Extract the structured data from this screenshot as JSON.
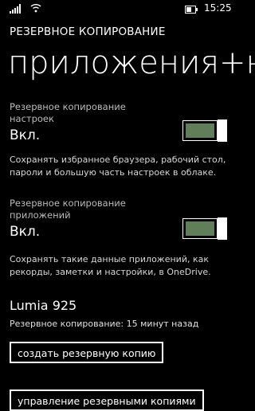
{
  "status_bar": {
    "time": "15:25",
    "signal_icon": "signal-icon",
    "wifi_icon": "wifi-icon",
    "battery_icon": "battery-icon"
  },
  "app_title": "РЕЗЕРВНОЕ КОПИРОВАНИЕ",
  "page_title": "приложения+н",
  "settings_backup": {
    "label": "Резервное копирование настроек",
    "value": "Вкл.",
    "description": "Сохранять избранное браузера, рабочий стол, пароли и большую часть настроек в облаке."
  },
  "apps_backup": {
    "label": "Резервное копирование приложений",
    "value": "Вкл.",
    "description": "Сохранять такие данные приложений, как рекорды, заметки и настройки, в OneDrive."
  },
  "device": {
    "name": "Lumia 925",
    "last_backup": "Резервное копирование: 15 минут назад"
  },
  "buttons": {
    "create_backup": "создать резервную копию",
    "manage_backups": "управление резервными копиями"
  },
  "colors": {
    "background": "#000000",
    "toggle_fill": "#617e5b"
  }
}
